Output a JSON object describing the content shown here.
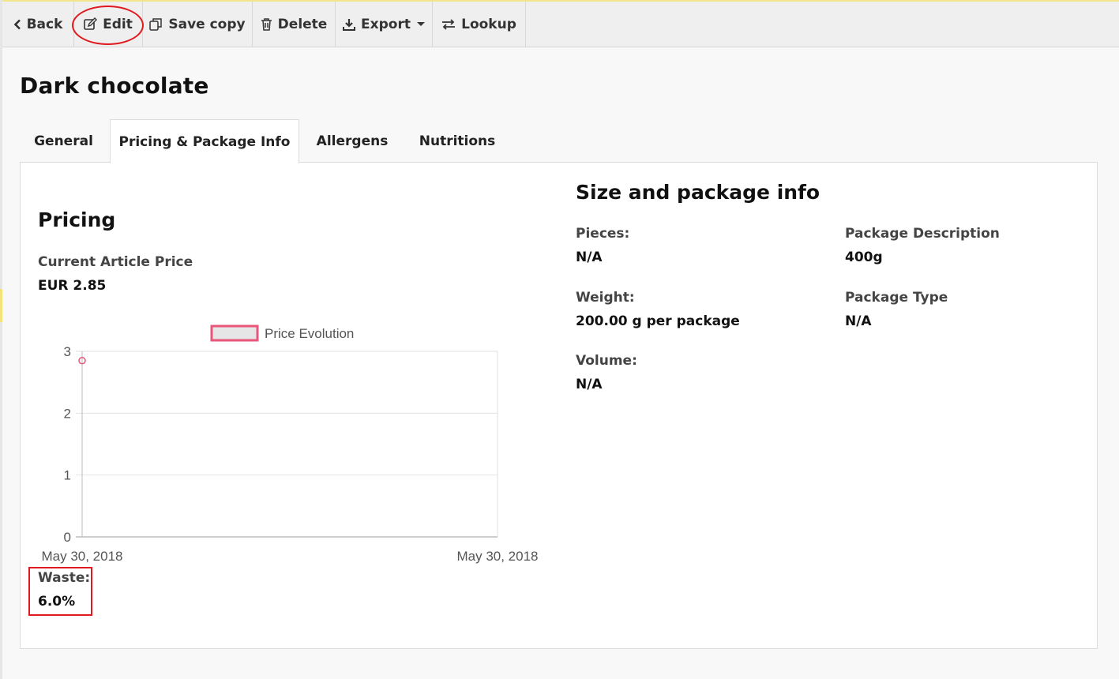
{
  "toolbar": {
    "back_label": "Back",
    "edit_label": "Edit",
    "save_copy_label": "Save copy",
    "delete_label": "Delete",
    "export_label": "Export",
    "lookup_label": "Lookup"
  },
  "page": {
    "title": "Dark chocolate"
  },
  "tabs": [
    {
      "label": "General"
    },
    {
      "label": "Pricing & Package Info",
      "active": true
    },
    {
      "label": "Allergens"
    },
    {
      "label": "Nutritions"
    }
  ],
  "pricing": {
    "heading": "Pricing",
    "current_price_label": "Current Article Price",
    "current_price_value": "EUR 2.85",
    "waste_label": "Waste:",
    "waste_value": "6.0%"
  },
  "chart_data": {
    "type": "line",
    "legend": [
      {
        "name": "Price Evolution",
        "placement": "top-center"
      }
    ],
    "x_tick_labels": [
      "May 30, 2018",
      "May 30, 2018"
    ],
    "y_tick_labels": [
      "0",
      "1",
      "2",
      "3"
    ],
    "ylim": [
      0,
      3
    ],
    "grid": true,
    "series": [
      {
        "name": "Price Evolution",
        "points": [
          {
            "x": "May 30, 2018",
            "y": 2.85
          }
        ]
      }
    ],
    "colors": {
      "series": "#e8567a",
      "legend_fill": "#e6e6e6"
    }
  },
  "package": {
    "heading": "Size and package info",
    "pieces_label": "Pieces:",
    "pieces_value": "N/A",
    "weight_label": "Weight:",
    "weight_value": "200.00 g per package",
    "volume_label": "Volume:",
    "volume_value": "N/A",
    "description_label": "Package Description",
    "description_value": "400g",
    "type_label": "Package Type",
    "type_value": "N/A"
  },
  "colors": {
    "annotation": "#e0191e"
  }
}
